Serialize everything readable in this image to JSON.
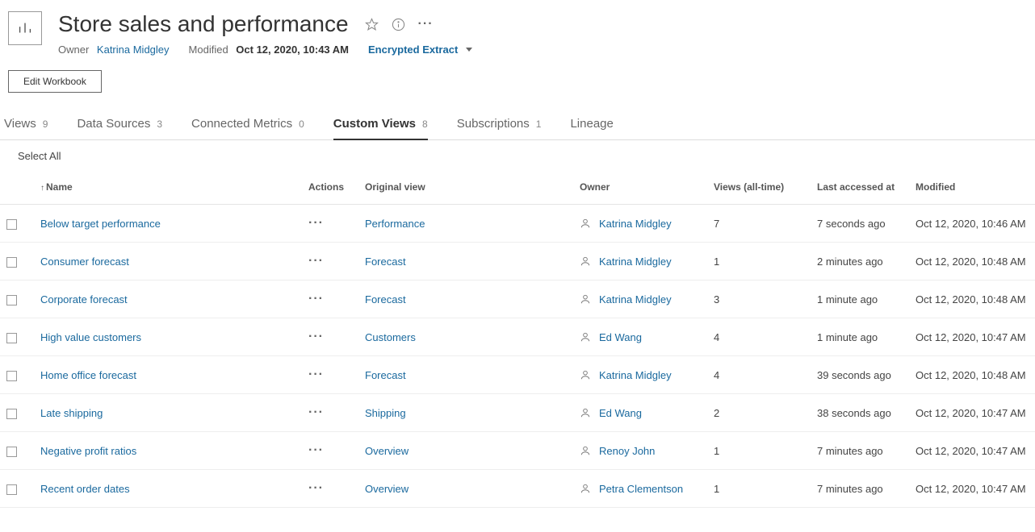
{
  "header": {
    "title": "Store sales and performance",
    "ownerLabel": "Owner",
    "owner": "Katrina Midgley",
    "modifiedLabel": "Modified",
    "modified": "Oct 12, 2020, 10:43 AM",
    "encryptedLabel": "Encrypted Extract"
  },
  "editButton": "Edit Workbook",
  "tabs": [
    {
      "label": "Views",
      "count": "9"
    },
    {
      "label": "Data Sources",
      "count": "3"
    },
    {
      "label": "Connected Metrics",
      "count": "0"
    },
    {
      "label": "Custom Views",
      "count": "8"
    },
    {
      "label": "Subscriptions",
      "count": "1"
    },
    {
      "label": "Lineage",
      "count": ""
    }
  ],
  "activeTab": 3,
  "selectAll": "Select All",
  "columns": {
    "name": "Name",
    "actions": "Actions",
    "originalView": "Original view",
    "owner": "Owner",
    "viewsAll": "Views (all-time)",
    "lastAccessed": "Last accessed at",
    "modified": "Modified"
  },
  "rows": [
    {
      "name": "Below target performance",
      "originalView": "Performance",
      "owner": "Katrina Midgley",
      "views": "7",
      "lastAccessed": "7 seconds ago",
      "modified": "Oct 12, 2020, 10:46 AM"
    },
    {
      "name": "Consumer forecast",
      "originalView": "Forecast",
      "owner": "Katrina Midgley",
      "views": "1",
      "lastAccessed": "2 minutes ago",
      "modified": "Oct 12, 2020, 10:48 AM"
    },
    {
      "name": "Corporate forecast",
      "originalView": "Forecast",
      "owner": "Katrina Midgley",
      "views": "3",
      "lastAccessed": "1 minute ago",
      "modified": "Oct 12, 2020, 10:48 AM"
    },
    {
      "name": "High value customers",
      "originalView": "Customers",
      "owner": "Ed Wang",
      "views": "4",
      "lastAccessed": "1 minute ago",
      "modified": "Oct 12, 2020, 10:47 AM"
    },
    {
      "name": "Home office forecast",
      "originalView": "Forecast",
      "owner": "Katrina Midgley",
      "views": "4",
      "lastAccessed": "39 seconds ago",
      "modified": "Oct 12, 2020, 10:48 AM"
    },
    {
      "name": "Late shipping",
      "originalView": "Shipping",
      "owner": "Ed Wang",
      "views": "2",
      "lastAccessed": "38 seconds ago",
      "modified": "Oct 12, 2020, 10:47 AM"
    },
    {
      "name": "Negative profit ratios",
      "originalView": "Overview",
      "owner": "Renoy John",
      "views": "1",
      "lastAccessed": "7 minutes ago",
      "modified": "Oct 12, 2020, 10:47 AM"
    },
    {
      "name": "Recent order dates",
      "originalView": "Overview",
      "owner": "Petra Clementson",
      "views": "1",
      "lastAccessed": "7 minutes ago",
      "modified": "Oct 12, 2020, 10:47 AM"
    }
  ]
}
